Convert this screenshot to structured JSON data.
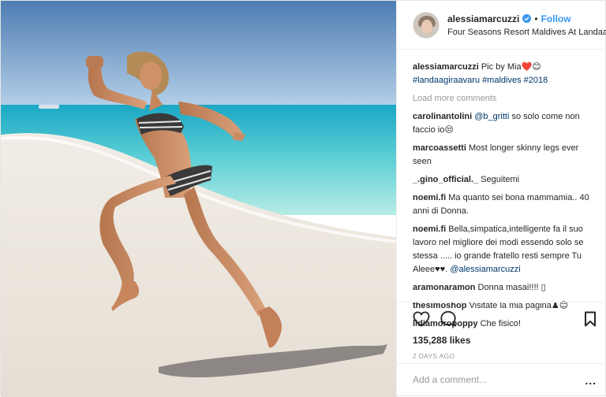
{
  "header": {
    "username": "alessiamarcuzzi",
    "follow_label": "Follow",
    "location": "Four Seasons Resort Maldives At Landaa ..."
  },
  "caption": {
    "username": "alessiamarcuzzi",
    "text": "Pic by Mia❤️😊",
    "hashtags": "#landaagiraavaru #maldives #2018"
  },
  "load_more": "Load more comments",
  "comments": [
    {
      "user": "carolinantolini",
      "mention": "@b_gritti",
      "text": "so solo come non faccio io😒"
    },
    {
      "user": "marcoassetti",
      "text": "Most longer skinny legs ever seen"
    },
    {
      "user": "_.gino_official._",
      "text": "Seguitemi"
    },
    {
      "user": "noemi.fi",
      "text": "Ma quanto sei bona mammamia.. 40 anni di Donna."
    },
    {
      "user": "noemi.fi",
      "text": "Bella,simpatica,intelligente fa il suo lavoro nel migliore dei modi essendo solo se stessa ..... io grande fratello resti sempre Tu Aleee♥♥.",
      "mention": "@alessiamarcuzzi"
    },
    {
      "user": "aramonaramon",
      "text": "Donna masai!!!! ▯"
    },
    {
      "user": "thesimoshop",
      "text": "Visitate la mia pagina♟😊"
    },
    {
      "user": "lidiamoropoppy",
      "text": "Che fisico!"
    }
  ],
  "likes": "135,288 likes",
  "timestamp": "2 DAYS AGO",
  "add_comment_placeholder": "Add a comment...",
  "more_label": "...",
  "colors": {
    "link": "#003569",
    "follow": "#3897f0",
    "muted": "#999999",
    "verified": "#3897f0"
  }
}
